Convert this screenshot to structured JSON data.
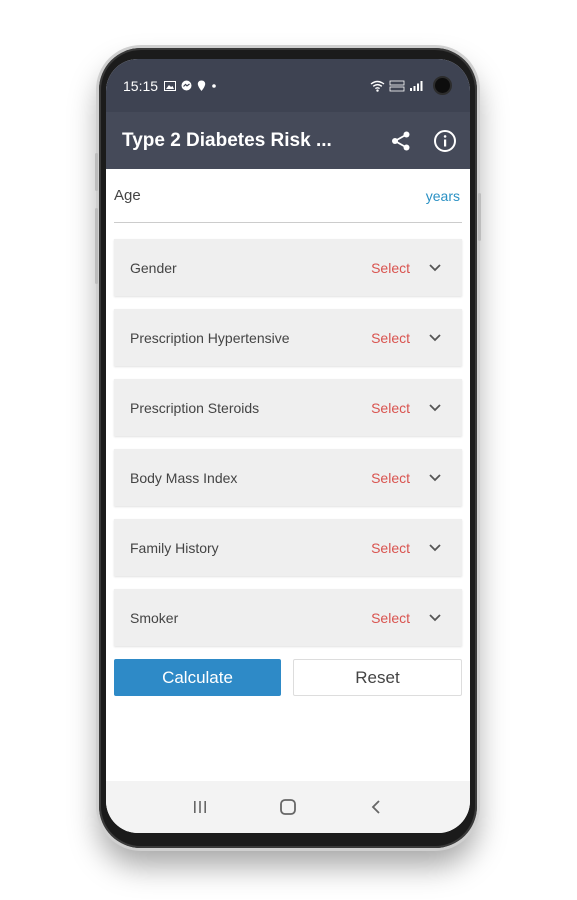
{
  "status": {
    "time": "15:15",
    "icons": [
      "image-icon",
      "messenger-icon",
      "location-icon",
      "dot-icon"
    ],
    "right": [
      "wifi-icon",
      "volte-icon",
      "signal-icon"
    ]
  },
  "appbar": {
    "title": "Type 2 Diabetes Risk ...",
    "actions": [
      "share-icon",
      "info-icon"
    ]
  },
  "form": {
    "age": {
      "label": "Age",
      "unit": "years",
      "value": ""
    },
    "fields": [
      {
        "label": "Gender",
        "value": "Select"
      },
      {
        "label": "Prescription Hypertensive",
        "value": "Select"
      },
      {
        "label": "Prescription Steroids",
        "value": "Select"
      },
      {
        "label": "Body Mass Index",
        "value": "Select"
      },
      {
        "label": "Family History",
        "value": "Select"
      },
      {
        "label": "Smoker",
        "value": "Select"
      }
    ],
    "calculate_label": "Calculate",
    "reset_label": "Reset"
  },
  "navbar": [
    "recents-icon",
    "home-icon",
    "back-icon"
  ],
  "colors": {
    "statusbar": "#3e4352",
    "appbar": "#454a59",
    "accent": "#2e8ac7",
    "select": "#d9534f",
    "unit": "#2a91c4"
  }
}
